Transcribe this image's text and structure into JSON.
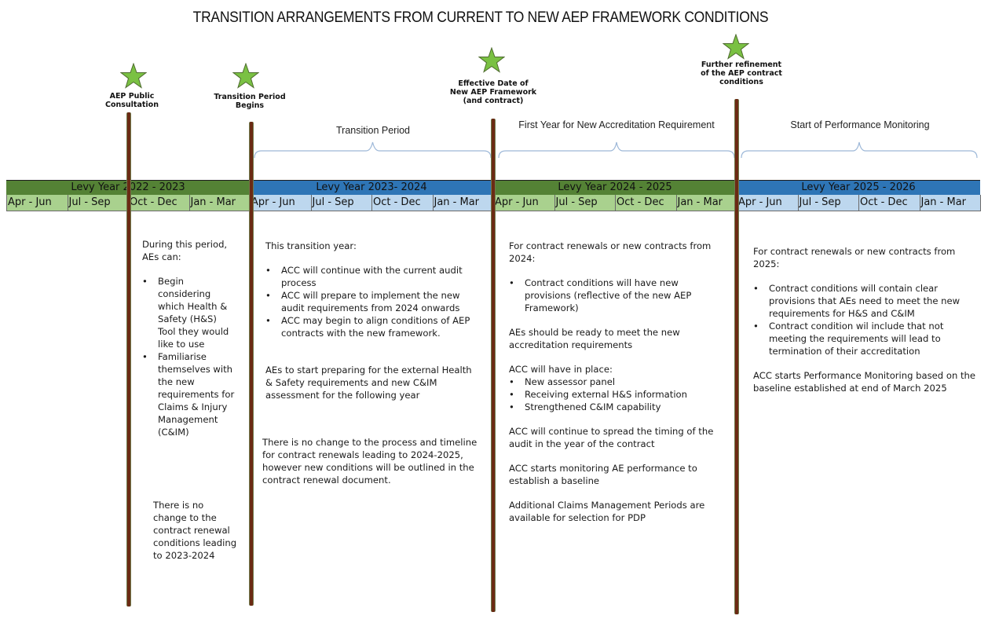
{
  "title": "TRANSITION ARRANGEMENTS FROM CURRENT TO NEW AEP FRAMEWORK CONDITIONS",
  "colors": {
    "star_fill": "#7ac143",
    "star_stroke": "#4e6b2e",
    "pole": "#6b2a14",
    "year_green": "#548235",
    "year_blue": "#2e75b6",
    "quarter_green": "#a9d18e",
    "quarter_blue": "#bdd7ee",
    "brace": "#9db8d8"
  },
  "milestones": [
    {
      "label_line1": "AEP Public",
      "label_line2": "Consultation",
      "label_line3": ""
    },
    {
      "label_line1": "Transition Period",
      "label_line2": "Begins",
      "label_line3": ""
    },
    {
      "label_line1": "Effective Date of",
      "label_line2": "New AEP Framework",
      "label_line3": "(and contract)"
    },
    {
      "label_line1": "Further refinement",
      "label_line2": "of the AEP contract",
      "label_line3": "conditions"
    }
  ],
  "periods": [
    {
      "label": "Transition Period"
    },
    {
      "label": "First Year for New Accreditation Requirement"
    },
    {
      "label": "Start of Performance Monitoring"
    }
  ],
  "levy_years": [
    {
      "label": "Levy Year 2022 - 2023",
      "quarters": [
        "Apr - Jun",
        "Jul - Sep",
        "Oct - Dec",
        "Jan - Mar"
      ]
    },
    {
      "label": "Levy Year 2023- 2024",
      "quarters": [
        "Apr - Jun",
        "Jul - Sep",
        "Oct - Dec",
        "Jan - Mar"
      ]
    },
    {
      "label": "Levy Year 2024 - 2025",
      "quarters": [
        "Apr - Jun",
        "Jul - Sep",
        "Oct - Dec",
        "Jan - Mar"
      ]
    },
    {
      "label": "Levy Year 2025 - 2026",
      "quarters": [
        "Apr - Jun",
        "Jul - Sep",
        "Oct - Dec",
        "Jan - Mar"
      ]
    }
  ],
  "columns": {
    "col1": {
      "intro": "During this period, AEs can:",
      "bullets": [
        "Begin considering which Health & Safety  (H&S) Tool they would like to use",
        "Familiarise themselves with the new requirements for Claims & Injury Management (C&IM)"
      ],
      "note": "There is no change to the contract renewal conditions leading to 2023-2024"
    },
    "col2": {
      "intro": "This transition year:",
      "bullets": [
        "ACC will continue with the current audit process",
        "ACC will prepare to implement the new audit requirements from 2024 onwards",
        "ACC may begin to align conditions of AEP contracts with the new framework."
      ],
      "para1": "AEs to start preparing for the external Health & Safety requirements and new C&IM assessment  for the following year",
      "para2": "There is no change to the process and timeline for contract renewals leading to 2024-2025, however new conditions will be outlined in the contract renewal document."
    },
    "col3": {
      "intro": "For contract renewals or new contracts from 2024:",
      "bullets": [
        "Contract conditions will have new provisions (reflective of the new AEP Framework)"
      ],
      "para1": "AEs should be ready to meet the new accreditation requirements",
      "para2": "ACC will have in place:",
      "bullets2": [
        "New assessor panel",
        "Receiving external H&S information",
        "Strengthened C&IM capability"
      ],
      "para3": "ACC will continue to spread the timing of the audit in the year of the contract",
      "para4": "ACC starts monitoring  AE performance to establish a baseline",
      "para5": "Additional Claims Management Periods are available for selection for PDP"
    },
    "col4": {
      "intro": "For contract renewals or new contracts from 2025:",
      "bullets": [
        "Contract conditions will  contain clear provisions that AEs need to meet the new requirements for H&S and C&IM",
        "Contract condition wil include that not meeting the requirements will lead to termination of their accreditation"
      ],
      "para1": "ACC starts Performance Monitoring based on the baseline established at end of March 2025"
    }
  }
}
